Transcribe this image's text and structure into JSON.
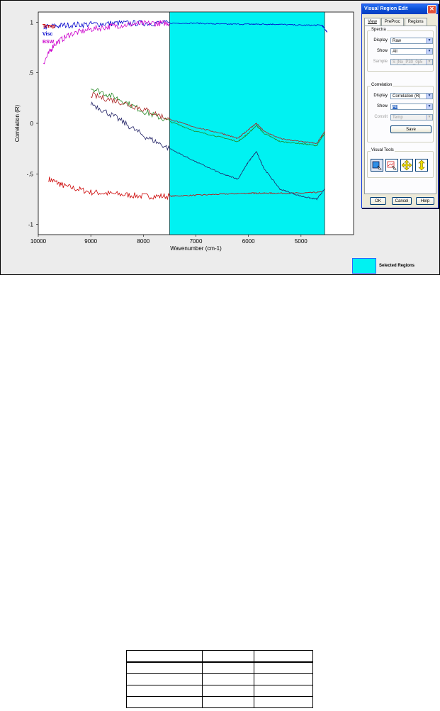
{
  "chart_data": {
    "type": "line",
    "ylabel": "Correlation (R)",
    "xlabel": "Wavenumber (cm-1)",
    "x_ticks": [
      10000,
      9000,
      8000,
      7000,
      6000,
      5000
    ],
    "y_ticks": [
      "1",
      ".5",
      "0",
      "-.5",
      "-1"
    ],
    "y_tick_values": [
      1,
      0.5,
      0,
      -0.5,
      -1
    ],
    "xlim": [
      10000,
      4000
    ],
    "ylim": [
      -1.1,
      1.1
    ],
    "selected_region": [
      7500,
      4550
    ],
    "selected_region_color": "#00f2f2",
    "selected_region_label": "Selected Regions",
    "legend": [
      {
        "label": "Temp",
        "color": "#cc0000"
      },
      {
        "label": "Visc",
        "color": "#0000cc"
      },
      {
        "label": "BSW",
        "color": "#cc00cc"
      }
    ],
    "series": [
      {
        "name": "Temp",
        "color": "#cc0000",
        "x": [
          9800,
          9500,
          9000,
          8500,
          8000,
          7500,
          7000,
          6500,
          6000,
          5800,
          5500,
          5000,
          4600
        ],
        "y": [
          -0.55,
          -0.62,
          -0.68,
          -0.7,
          -0.72,
          -0.72,
          -0.71,
          -0.7,
          -0.69,
          -0.69,
          -0.69,
          -0.69,
          -0.68
        ]
      },
      {
        "name": "Visc",
        "color": "#0000cc",
        "x": [
          9900,
          9500,
          9000,
          8500,
          8000,
          7500,
          7000,
          6500,
          6000,
          5800,
          5500,
          5000,
          4600,
          4500
        ],
        "y": [
          0.95,
          0.97,
          0.98,
          0.99,
          0.99,
          0.99,
          0.99,
          0.98,
          0.98,
          0.98,
          0.98,
          0.97,
          0.97,
          0.9
        ]
      },
      {
        "name": "BSW",
        "color": "#cc00cc",
        "x": [
          9900,
          9700,
          9400,
          9000,
          8600,
          8200,
          7800,
          7500
        ],
        "y": [
          0.6,
          0.78,
          0.88,
          0.93,
          0.96,
          0.98,
          0.99,
          0.99
        ]
      },
      {
        "name": "",
        "color": "#228822",
        "x": [
          9000,
          8500,
          8000,
          7500,
          7000,
          6500,
          6200,
          6000,
          5850,
          5700,
          5400,
          5000,
          4700,
          4550
        ],
        "y": [
          0.35,
          0.25,
          0.12,
          0.02,
          -0.08,
          -0.14,
          -0.18,
          -0.1,
          -0.02,
          -0.1,
          -0.18,
          -0.2,
          -0.22,
          -0.1
        ]
      },
      {
        "name": "",
        "color": "#222266",
        "x": [
          9000,
          8500,
          8000,
          7500,
          7000,
          6500,
          6200,
          6000,
          5850,
          5700,
          5400,
          5000,
          4700,
          4550
        ],
        "y": [
          0.2,
          0.05,
          -0.12,
          -0.25,
          -0.38,
          -0.5,
          -0.55,
          -0.38,
          -0.28,
          -0.45,
          -0.65,
          -0.72,
          -0.75,
          -0.65
        ]
      },
      {
        "name": "",
        "color": "#aa2222",
        "x": [
          9000,
          8500,
          8000,
          7500,
          7000,
          6500,
          6200,
          6000,
          5850,
          5700,
          5400,
          5000,
          4700,
          4550
        ],
        "y": [
          0.28,
          0.22,
          0.14,
          0.04,
          -0.04,
          -0.1,
          -0.15,
          -0.06,
          0.0,
          -0.08,
          -0.15,
          -0.18,
          -0.2,
          -0.08
        ]
      }
    ]
  },
  "dialog": {
    "title": "Visual Region Edit",
    "tabs": [
      "View",
      "PreProc",
      "Regions"
    ],
    "spectra": {
      "group": "Spectra",
      "display_label": "Display",
      "display_value": "Raw",
      "show_label": "Show",
      "show_value": "All",
      "sample_label": "Sample",
      "sample_value": "S (Nx_P30_0p5"
    },
    "correlation": {
      "group": "Correlation",
      "display_label": "Display",
      "display_value": "Correlation (R)",
      "show_label": "Show",
      "show_value": "All",
      "constit_label": "Constit",
      "constit_value": "Temp",
      "save_label": "Save"
    },
    "visual_tools_label": "Visual Tools",
    "ok_label": "OK",
    "cancel_label": "Cancel",
    "help_label": "Help"
  },
  "table": {
    "rows": [
      [
        "",
        "",
        ""
      ],
      [
        "",
        "",
        ""
      ],
      [
        "",
        "",
        ""
      ],
      [
        "",
        "",
        ""
      ],
      [
        "",
        "",
        ""
      ]
    ]
  }
}
